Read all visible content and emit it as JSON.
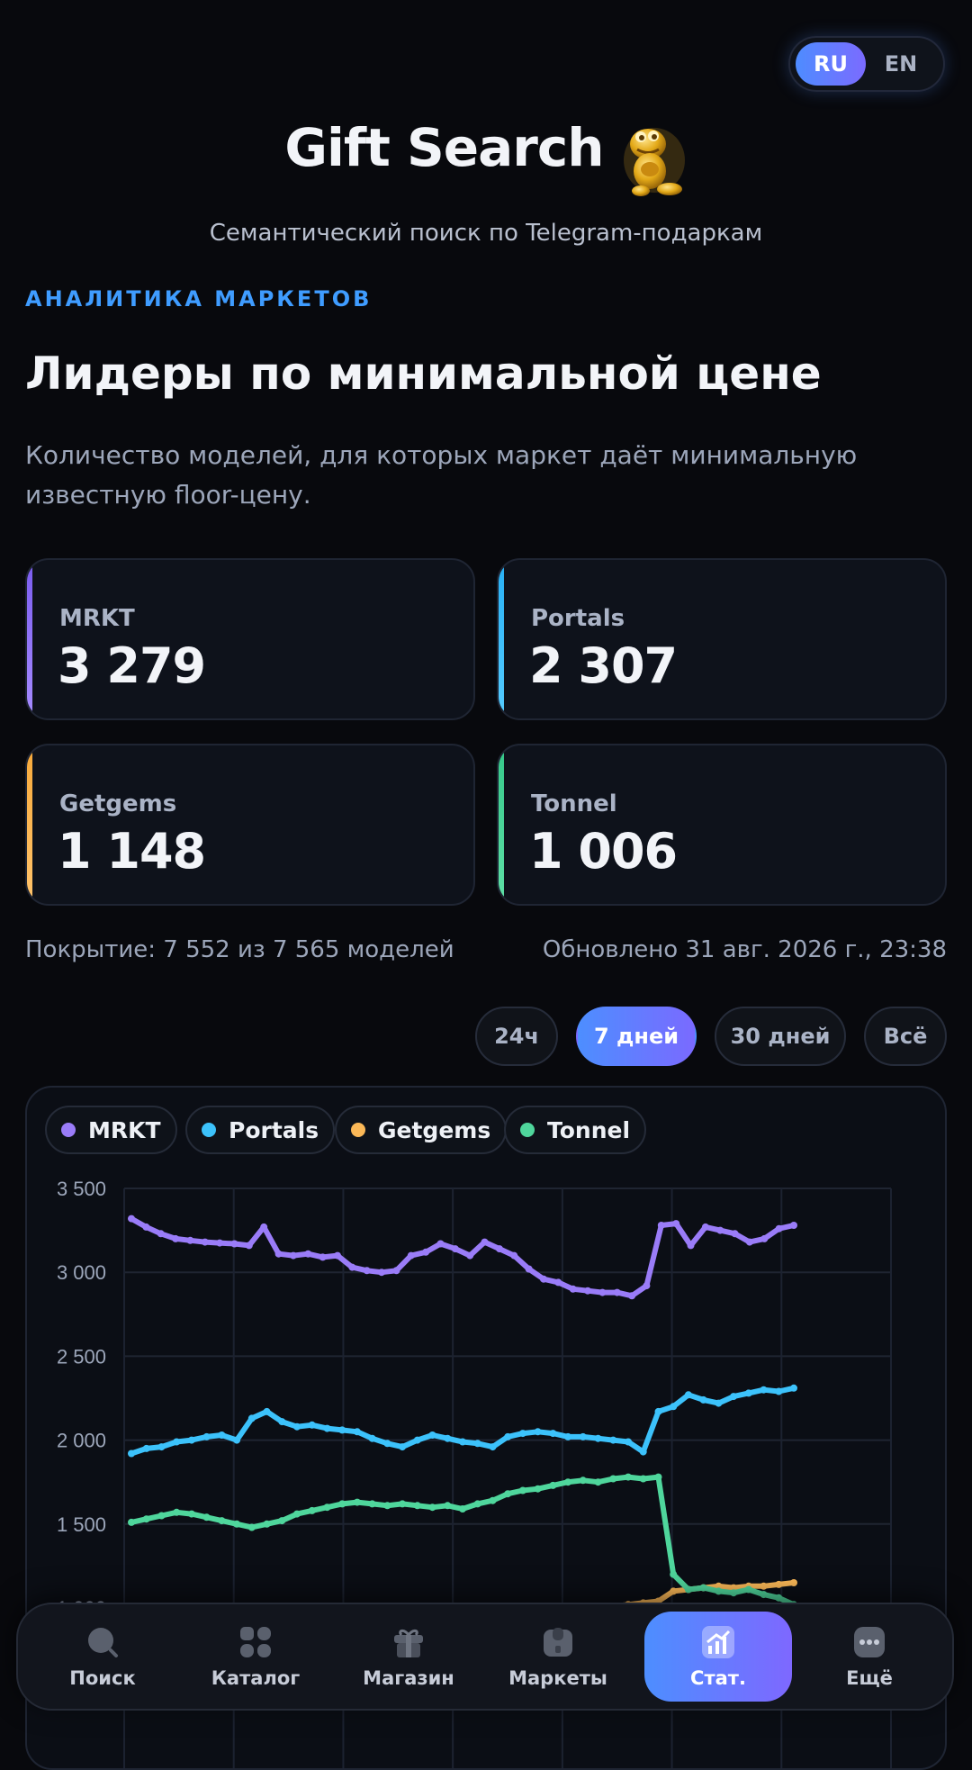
{
  "lang": {
    "ru": "RU",
    "en": "EN",
    "active": "RU"
  },
  "brand": {
    "title": "Gift Search",
    "logo_icon": "golden-frog-icon"
  },
  "subtitle": "Семантический поиск по Telegram-подаркам",
  "section": {
    "eyebrow": "АНАЛИТИКА МАРКЕТОВ",
    "title": "Лидеры по минимальной цене",
    "description": "Количество моделей, для которых маркет даёт минимальную известную floor-цену."
  },
  "stats": [
    {
      "label": "MRKT",
      "value": "3 279",
      "color": "#8b6cf6"
    },
    {
      "label": "Portals",
      "value": "2 307",
      "color": "#38bdf8"
    },
    {
      "label": "Getgems",
      "value": "1 148",
      "color": "#fbbf5a"
    },
    {
      "label": "Tonnel",
      "value": "1 006",
      "color": "#4ad295"
    }
  ],
  "coverage": "Покрытие: 7 552 из 7 565 моделей",
  "updated": "Обновлено 31 авг. 2026 г., 23:38",
  "ranges": {
    "h24": "24ч",
    "d7": "7 дней",
    "d30": "30 дней",
    "all": "Всё",
    "active": "7 дней"
  },
  "chart_data": {
    "type": "line",
    "ylim": [
      800,
      3600
    ],
    "yticks": [
      "3 500",
      "3 000",
      "2 500",
      "2 000",
      "1 500",
      "1 000"
    ],
    "ytick_values": [
      3500,
      3000,
      2500,
      2000,
      1500,
      1000
    ],
    "grid": true,
    "legend": "top-left",
    "series": [
      {
        "name": "MRKT",
        "color": "#9a7cf8",
        "values": [
          3320,
          3270,
          3230,
          3200,
          3190,
          3180,
          3175,
          3170,
          3160,
          3270,
          3110,
          3100,
          3110,
          3090,
          3100,
          3030,
          3010,
          3000,
          3010,
          3100,
          3120,
          3170,
          3140,
          3100,
          3180,
          3140,
          3100,
          3020,
          2960,
          2940,
          2900,
          2890,
          2880,
          2880,
          2860,
          2920,
          3280,
          3290,
          3160,
          3270,
          3250,
          3230,
          3180,
          3200,
          3260,
          3280
        ]
      },
      {
        "name": "Portals",
        "color": "#3cc2fb",
        "values": [
          1920,
          1950,
          1960,
          1990,
          2000,
          2020,
          2030,
          2000,
          2130,
          2170,
          2110,
          2080,
          2090,
          2070,
          2060,
          2050,
          2010,
          1980,
          1960,
          2000,
          2030,
          2010,
          1990,
          1980,
          1960,
          2020,
          2040,
          2050,
          2040,
          2020,
          2020,
          2010,
          2000,
          1990,
          1930,
          2170,
          2200,
          2270,
          2240,
          2220,
          2260,
          2280,
          2300,
          2290,
          2310
        ]
      },
      {
        "name": "Getgems",
        "color": "#fbb857",
        "values": [
          null,
          null,
          null,
          null,
          null,
          null,
          null,
          null,
          null,
          null,
          null,
          null,
          null,
          null,
          null,
          null,
          null,
          null,
          null,
          null,
          null,
          null,
          null,
          null,
          null,
          null,
          null,
          null,
          980,
          990,
          1000,
          1010,
          1010,
          1020,
          1030,
          1040,
          1100,
          1110,
          1120,
          1130,
          1120,
          1130,
          1130,
          1140,
          1150
        ]
      },
      {
        "name": "Tonnel",
        "color": "#4fd69c",
        "values": [
          1510,
          1530,
          1550,
          1570,
          1560,
          1540,
          1520,
          1500,
          1480,
          1500,
          1520,
          1560,
          1580,
          1600,
          1620,
          1630,
          1620,
          1610,
          1620,
          1610,
          1600,
          1610,
          1590,
          1620,
          1640,
          1680,
          1700,
          1710,
          1730,
          1750,
          1760,
          1750,
          1770,
          1780,
          1770,
          1780,
          1200,
          1110,
          1120,
          1100,
          1090,
          1110,
          1080,
          1060,
          1020
        ]
      }
    ]
  },
  "nav": [
    {
      "label": "Поиск",
      "icon": "search-icon"
    },
    {
      "label": "Каталог",
      "icon": "catalog-grid-icon"
    },
    {
      "label": "Магазин",
      "icon": "gift-box-icon"
    },
    {
      "label": "Маркеты",
      "icon": "market-bag-icon"
    },
    {
      "label": "Стат.",
      "icon": "stats-chart-icon",
      "active": true
    },
    {
      "label": "Ещё",
      "icon": "more-dots-icon"
    }
  ]
}
